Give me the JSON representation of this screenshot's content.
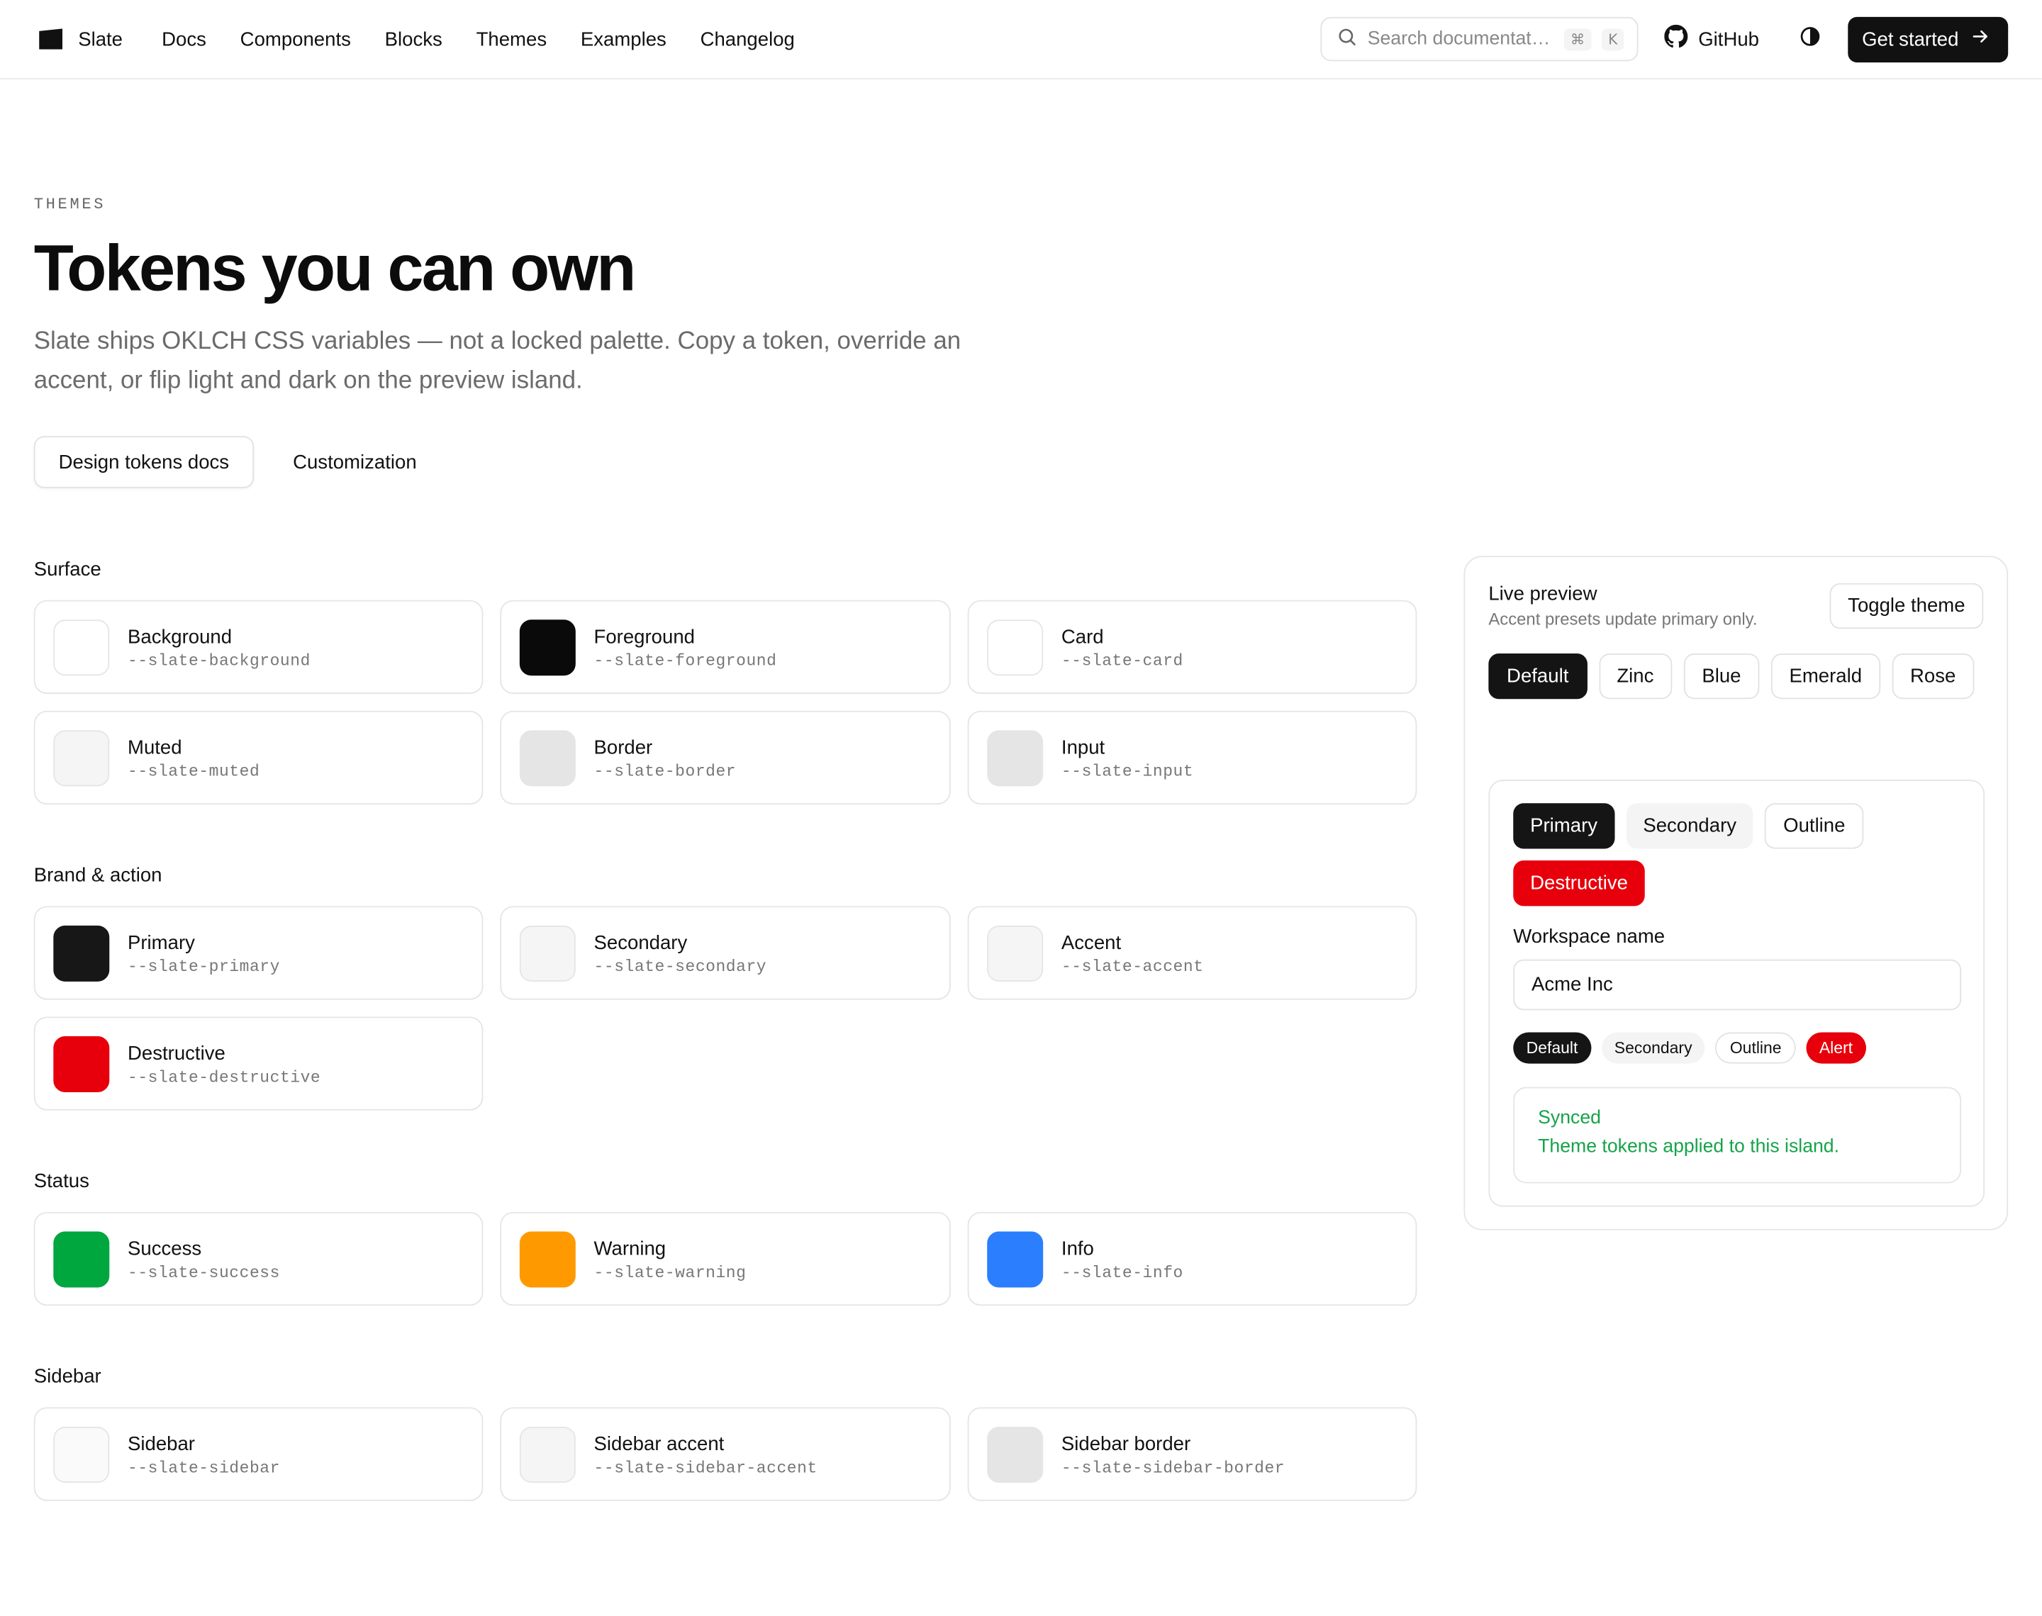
{
  "header": {
    "brand": "Slate",
    "nav": [
      "Docs",
      "Components",
      "Blocks",
      "Themes",
      "Examples",
      "Changelog"
    ],
    "search_placeholder": "Search documentation…",
    "search_kbd_cmd": "⌘",
    "search_kbd_key": "K",
    "github_label": "GitHub",
    "cta_label": "Get started"
  },
  "hero": {
    "eyebrow": "THEMES",
    "title": "Tokens you can own",
    "lede": "Slate ships OKLCH CSS variables — not a locked palette. Copy a token, override an accent, or flip light and dark on the preview island.",
    "primary_action": "Design tokens docs",
    "secondary_action": "Customization"
  },
  "groups": [
    {
      "label": "Surface",
      "tokens": [
        {
          "name": "Background",
          "var": "--slate-background",
          "color": "#ffffff"
        },
        {
          "name": "Foreground",
          "var": "--slate-foreground",
          "color": "#0a0a0a"
        },
        {
          "name": "Card",
          "var": "--slate-card",
          "color": "#ffffff"
        },
        {
          "name": "Muted",
          "var": "--slate-muted",
          "color": "#f5f5f5"
        },
        {
          "name": "Border",
          "var": "--slate-border",
          "color": "#e5e5e5"
        },
        {
          "name": "Input",
          "var": "--slate-input",
          "color": "#e5e5e5"
        }
      ]
    },
    {
      "label": "Brand & action",
      "tokens": [
        {
          "name": "Primary",
          "var": "--slate-primary",
          "color": "#171717"
        },
        {
          "name": "Secondary",
          "var": "--slate-secondary",
          "color": "#f5f5f5"
        },
        {
          "name": "Accent",
          "var": "--slate-accent",
          "color": "#f5f5f5"
        },
        {
          "name": "Destructive",
          "var": "--slate-destructive",
          "color": "#e7000b"
        }
      ]
    },
    {
      "label": "Status",
      "tokens": [
        {
          "name": "Success",
          "var": "--slate-success",
          "color": "#00a63e"
        },
        {
          "name": "Warning",
          "var": "--slate-warning",
          "color": "#fe9a00"
        },
        {
          "name": "Info",
          "var": "--slate-info",
          "color": "#2b7fff"
        }
      ]
    },
    {
      "label": "Sidebar",
      "tokens": [
        {
          "name": "Sidebar",
          "var": "--slate-sidebar",
          "color": "#fafafa"
        },
        {
          "name": "Sidebar accent",
          "var": "--slate-sidebar-accent",
          "color": "#f5f5f5"
        },
        {
          "name": "Sidebar border",
          "var": "--slate-sidebar-border",
          "color": "#e5e5e5"
        }
      ]
    }
  ],
  "preview": {
    "title": "Live preview",
    "subtitle": "Accent presets update primary only.",
    "toggle_label": "Toggle theme",
    "presets": [
      "Default",
      "Zinc",
      "Blue",
      "Emerald",
      "Rose"
    ],
    "active_preset": "Default",
    "buttons": {
      "primary": "Primary",
      "secondary": "Secondary",
      "outline": "Outline",
      "destructive": "Destructive"
    },
    "field_label": "Workspace name",
    "field_value": "Acme Inc",
    "badges": {
      "default": "Default",
      "secondary": "Secondary",
      "outline": "Outline",
      "alert": "Alert"
    },
    "alert_title": "Synced",
    "alert_desc": "Theme tokens applied to this island."
  }
}
